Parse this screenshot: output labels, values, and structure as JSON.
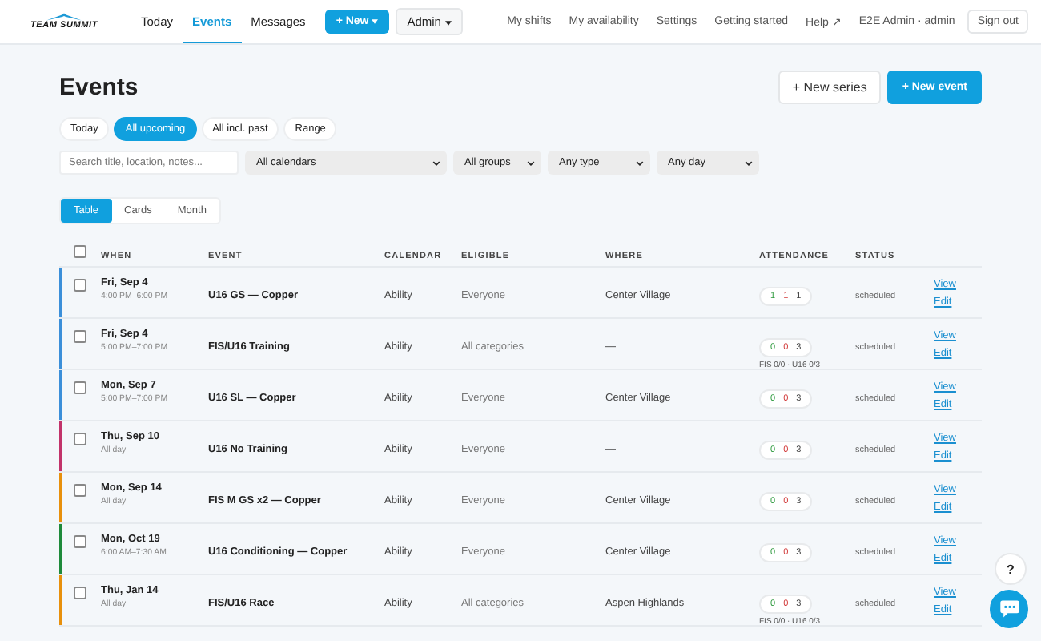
{
  "nav": {
    "logo": "TEAM SUMMIT",
    "items": [
      {
        "label": "Today",
        "selected": false
      },
      {
        "label": "Events",
        "selected": true
      },
      {
        "label": "Messages",
        "selected": false
      }
    ],
    "new_button": "+ New",
    "admin_button": "Admin",
    "right_links": [
      "My shifts",
      "My availability",
      "Settings",
      "Getting started",
      "Help ↗"
    ],
    "user": "E2E Admin · admin",
    "sign_out": "Sign out"
  },
  "page": {
    "title": "Events",
    "new_series": "+ New series",
    "new_event": "+ New event"
  },
  "ranges": [
    {
      "label": "Today",
      "selected": false
    },
    {
      "label": "All upcoming",
      "selected": true
    },
    {
      "label": "All incl. past",
      "selected": false
    },
    {
      "label": "Range",
      "selected": false
    }
  ],
  "search": {
    "placeholder": "Search title, location, notes..."
  },
  "filters": [
    {
      "value": "All calendars"
    },
    {
      "value": "All groups"
    },
    {
      "value": "Any type"
    },
    {
      "value": "Any day"
    }
  ],
  "views": [
    {
      "label": "Table",
      "selected": true
    },
    {
      "label": "Cards",
      "selected": false
    },
    {
      "label": "Month",
      "selected": false
    }
  ],
  "table": {
    "select_all_checked": false,
    "columns": [
      "WHEN",
      "EVENT",
      "CALENDAR",
      "ELIGIBLE",
      "WHERE",
      "ATTENDANCE",
      "STATUS"
    ],
    "rows": [
      {
        "color": "#3b8fd9",
        "checked": false,
        "date": "Fri, Sep 4",
        "time": "4:00 PM–6:00 PM",
        "event": "U16 GS — Copper",
        "calendar": "Ability",
        "eligible": "Everyone",
        "where": "Center Village",
        "attendance": [
          "1",
          "1",
          "1"
        ],
        "status": "scheduled",
        "view": "View",
        "edit": "Edit"
      },
      {
        "color": "#3b8fd9",
        "checked": false,
        "date": "Fri, Sep 4",
        "time": "5:00 PM–7:00 PM",
        "event": "FIS/U16 Training",
        "calendar": "Ability",
        "eligible": "All categories",
        "where": "—",
        "attendance": [
          "0",
          "0",
          "3"
        ],
        "detail": "FIS 0/0 · U16 0/3",
        "status": "scheduled",
        "view": "View",
        "edit": "Edit"
      },
      {
        "color": "#3b8fd9",
        "checked": false,
        "date": "Mon, Sep 7",
        "time": "5:00 PM–7:00 PM",
        "event": "U16 SL — Copper",
        "calendar": "Ability",
        "eligible": "Everyone",
        "where": "Center Village",
        "attendance": [
          "0",
          "0",
          "3"
        ],
        "status": "scheduled",
        "view": "View",
        "edit": "Edit"
      },
      {
        "color": "#c2336a",
        "checked": false,
        "date": "Thu, Sep 10",
        "time": "All day",
        "event": "U16 No Training",
        "calendar": "Ability",
        "eligible": "Everyone",
        "where": "—",
        "attendance": [
          "0",
          "0",
          "3"
        ],
        "status": "scheduled",
        "view": "View",
        "edit": "Edit"
      },
      {
        "color": "#e8900c",
        "checked": false,
        "date": "Mon, Sep 14",
        "time": "All day",
        "event": "FIS M GS x2 — Copper",
        "calendar": "Ability",
        "eligible": "Everyone",
        "where": "Center Village",
        "attendance": [
          "0",
          "0",
          "3"
        ],
        "status": "scheduled",
        "view": "View",
        "edit": "Edit"
      },
      {
        "color": "#1e8a3a",
        "checked": false,
        "date": "Mon, Oct 19",
        "time": "6:00 AM–7:30 AM",
        "event": "U16 Conditioning — Copper",
        "calendar": "Ability",
        "eligible": "Everyone",
        "where": "Center Village",
        "attendance": [
          "0",
          "0",
          "3"
        ],
        "status": "scheduled",
        "view": "View",
        "edit": "Edit"
      },
      {
        "color": "#e8900c",
        "checked": false,
        "date": "Thu, Jan 14",
        "time": "All day",
        "event": "FIS/U16 Race",
        "calendar": "Ability",
        "eligible": "All categories",
        "where": "Aspen Highlands",
        "attendance": [
          "0",
          "0",
          "3"
        ],
        "detail": "FIS 0/0 · U16 0/3",
        "status": "scheduled",
        "view": "View",
        "edit": "Edit"
      }
    ]
  },
  "help_button": "?"
}
